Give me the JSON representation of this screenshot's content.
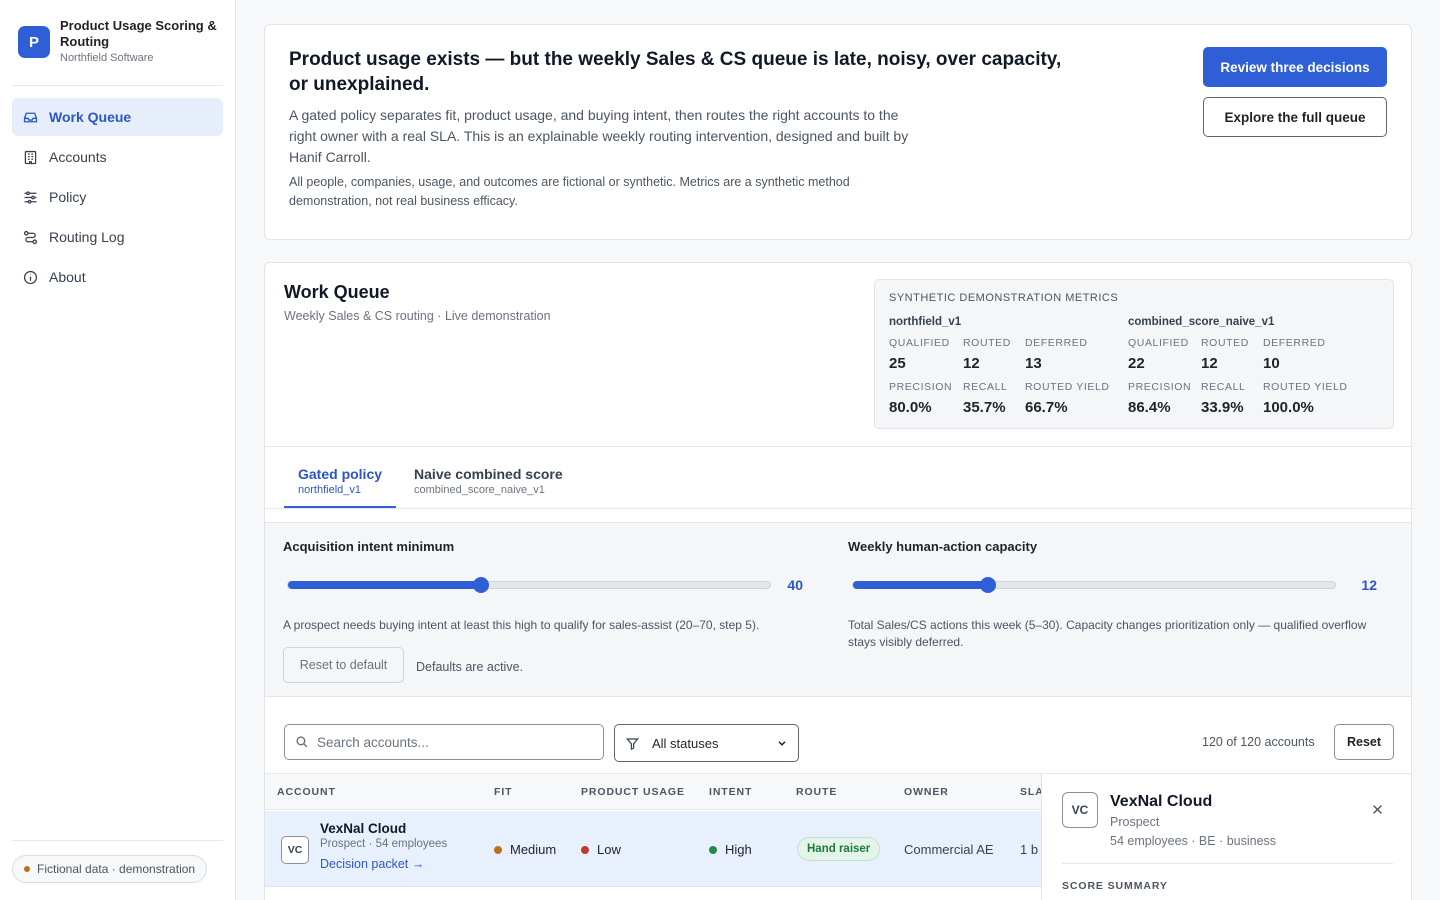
{
  "app": {
    "logo_letter": "P",
    "title": "Product Usage Scoring & Routing",
    "subtitle": "Northfield Software"
  },
  "sidebar": {
    "items": [
      {
        "label": "Work Queue",
        "icon": "inbox-icon",
        "active": true
      },
      {
        "label": "Accounts",
        "icon": "building-icon"
      },
      {
        "label": "Policy",
        "icon": "sliders-icon"
      },
      {
        "label": "Routing Log",
        "icon": "route-icon"
      },
      {
        "label": "About",
        "icon": "info-icon"
      }
    ],
    "footer_pill": "Fictional data · demonstration"
  },
  "hero": {
    "title": "Product usage exists — but the weekly Sales & CS queue is late, noisy, over capacity, or unexplained.",
    "lead": "A gated policy separates fit, product usage, and buying intent, then routes the right accounts to the right owner with a real SLA. This is an explainable weekly routing intervention, designed and built by Hanif Carroll.",
    "note": "All people, companies, usage, and outcomes are fictional or synthetic. Metrics are a synthetic method demonstration, not real business efficacy.",
    "primary_cta": "Review three decisions",
    "secondary_cta": "Explore the full queue"
  },
  "queue": {
    "title": "Work Queue",
    "subtitle": "Weekly Sales & CS routing · Live demonstration"
  },
  "metrics": {
    "title": "SYNTHETIC DEMONSTRATION METRICS",
    "groups": [
      {
        "name": "northfield_v1",
        "row1": [
          {
            "label": "QUALIFIED",
            "value": "25"
          },
          {
            "label": "ROUTED",
            "value": "12"
          },
          {
            "label": "DEFERRED",
            "value": "13"
          }
        ],
        "row2": [
          {
            "label": "PRECISION",
            "value": "80.0%"
          },
          {
            "label": "RECALL",
            "value": "35.7%"
          },
          {
            "label": "ROUTED YIELD",
            "value": "66.7%"
          }
        ]
      },
      {
        "name": "combined_score_naive_v1",
        "row1": [
          {
            "label": "QUALIFIED",
            "value": "22"
          },
          {
            "label": "ROUTED",
            "value": "12"
          },
          {
            "label": "DEFERRED",
            "value": "10"
          }
        ],
        "row2": [
          {
            "label": "PRECISION",
            "value": "86.4%"
          },
          {
            "label": "RECALL",
            "value": "33.9%"
          },
          {
            "label": "ROUTED YIELD",
            "value": "100.0%"
          }
        ]
      }
    ]
  },
  "tabs": [
    {
      "label": "Gated policy",
      "sub": "northfield_v1",
      "active": true
    },
    {
      "label": "Naive combined score",
      "sub": "combined_score_naive_v1",
      "active": false
    }
  ],
  "controls": {
    "intent": {
      "label": "Acquisition intent minimum",
      "value": "40",
      "fraction": 0.4,
      "description": "A prospect needs buying intent at least this high to qualify for sales-assist (20–70, step 5)."
    },
    "capacity": {
      "label": "Weekly human-action capacity",
      "value": "12",
      "fraction": 0.28,
      "description": "Total Sales/CS actions this week (5–30). Capacity changes prioritization only — qualified overflow stays visibly deferred."
    },
    "reset_default_label": "Reset to default",
    "defaults_note": "Defaults are active."
  },
  "toolbar": {
    "search_placeholder": "Search accounts...",
    "status_filter": "All statuses",
    "count_text": "120 of 120 accounts",
    "reset_label": "Reset"
  },
  "table": {
    "headers": [
      "ACCOUNT",
      "FIT",
      "PRODUCT USAGE",
      "INTENT",
      "ROUTE",
      "OWNER",
      "SLA"
    ],
    "rows": [
      {
        "initials": "VC",
        "name": "VexNal Cloud",
        "meta": "Prospect · 54 employees",
        "link": "Decision packet →",
        "fit": "Medium",
        "usage": "Low",
        "intent": "High",
        "route": "Hand raiser",
        "owner": "Commercial AE",
        "sla": "1 b"
      }
    ]
  },
  "colors": {
    "accent": "#2f5fd6",
    "medium": "#b8731a",
    "low": "#c0392b",
    "high": "#1e8a4a"
  },
  "detail": {
    "initials": "VC",
    "name": "VexNal Cloud",
    "type": "Prospect",
    "meta": "54 employees · BE · business",
    "section": "SCORE SUMMARY"
  }
}
